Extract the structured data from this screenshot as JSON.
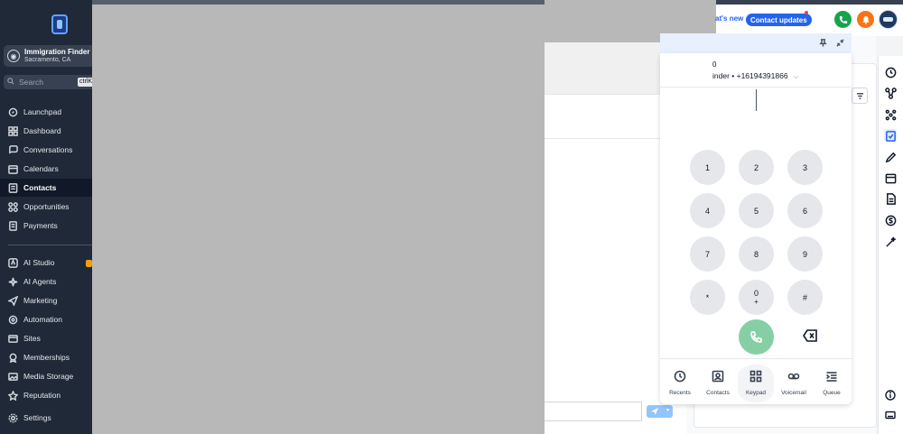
{
  "sidebar": {
    "account": {
      "name": "Immigration Finder",
      "location": "Sacramento, CA"
    },
    "search": {
      "placeholder": "Search",
      "shortcut": "ctrlK"
    },
    "items": [
      {
        "label": "Launchpad",
        "icon": "rocket-icon"
      },
      {
        "label": "Dashboard",
        "icon": "grid-icon"
      },
      {
        "label": "Conversations",
        "icon": "chat-bubble-icon"
      },
      {
        "label": "Calendars",
        "icon": "calendar-icon"
      },
      {
        "label": "Contacts",
        "icon": "contacts-icon",
        "active": true
      },
      {
        "label": "Opportunities",
        "icon": "opportunities-icon"
      },
      {
        "label": "Payments",
        "icon": "payments-icon"
      },
      {
        "label": "AI Studio",
        "icon": "ai-studio-icon"
      },
      {
        "label": "AI Agents",
        "icon": "sparkle-icon"
      },
      {
        "label": "Marketing",
        "icon": "send-icon"
      },
      {
        "label": "Automation",
        "icon": "automation-icon"
      },
      {
        "label": "Sites",
        "icon": "sites-icon"
      },
      {
        "label": "Memberships",
        "icon": "memberships-icon"
      },
      {
        "label": "Media Storage",
        "icon": "media-icon"
      },
      {
        "label": "Reputation",
        "icon": "star-icon"
      },
      {
        "label": "Settings",
        "icon": "gear-icon"
      }
    ]
  },
  "header": {
    "whats_new": "at's new",
    "contact_updates": "Contact updates",
    "accent_color": "#2563eb"
  },
  "dialer": {
    "partial_digit": "0",
    "from_line": "inder • +16194391866",
    "chevron": "⌵",
    "close": "×",
    "keys": [
      "1",
      "2",
      "3",
      "4",
      "5",
      "6",
      "7",
      "8",
      "9",
      "*",
      "0",
      "#"
    ],
    "zero_sub": "+",
    "tabs": [
      {
        "label": "Recents",
        "icon": "clock-icon"
      },
      {
        "label": "Contacts",
        "icon": "contact-card-icon"
      },
      {
        "label": "Keypad",
        "icon": "keypad-icon",
        "active": true
      },
      {
        "label": "Voicemail",
        "icon": "voicemail-icon"
      },
      {
        "label": "Queue",
        "icon": "queue-icon"
      }
    ],
    "call_color": "#86cfa5"
  },
  "right_panel": {
    "tiny_mark": "›"
  }
}
